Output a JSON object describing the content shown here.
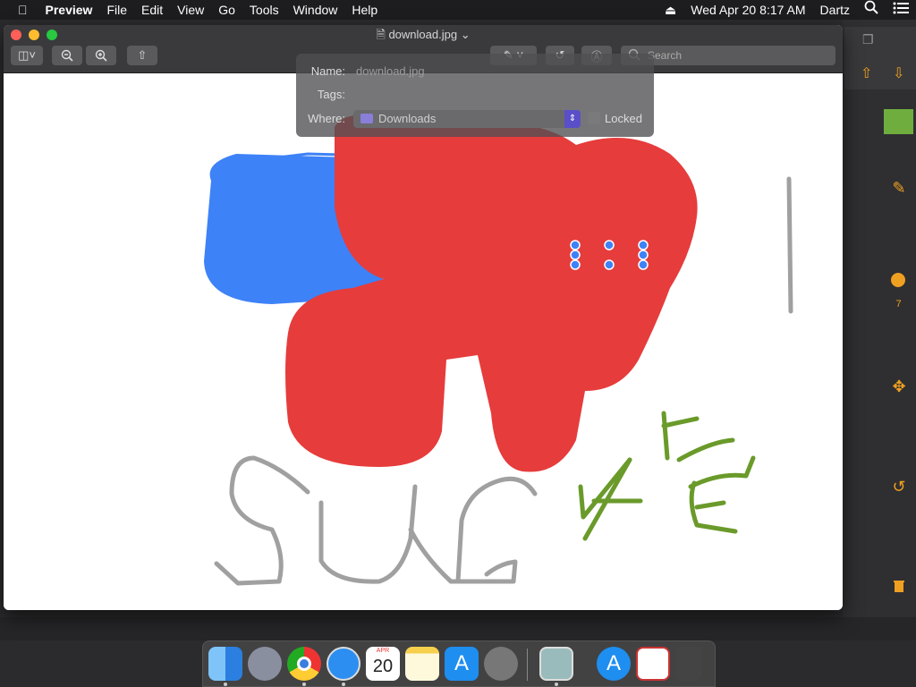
{
  "menubar": {
    "app": "Preview",
    "items": [
      "File",
      "Edit",
      "View",
      "Go",
      "Tools",
      "Window",
      "Help"
    ],
    "date": "Wed Apr 20",
    "time": "8:17 AM",
    "user": "Dartz"
  },
  "window": {
    "title": "download.jpg",
    "search_placeholder": "Search"
  },
  "popover": {
    "name_label": "Name:",
    "name_value": "download.jpg",
    "tags_label": "Tags:",
    "tags_value": "",
    "where_label": "Where:",
    "where_value": "Downloads",
    "locked_label": "Locked"
  },
  "inspector": {
    "size_value": "7"
  },
  "dock": {
    "calendar_month": "APR",
    "calendar_day": "20",
    "apps": [
      "Finder",
      "Launchpad",
      "Google Chrome",
      "Safari",
      "Calendar",
      "Notes",
      "App Store",
      "System Preferences",
      "Preview",
      "App Store Downloads",
      "Photo Booth",
      "Trash"
    ]
  },
  "colors": {
    "red_fill": "#e63c3c",
    "blue_fill": "#3e82f7",
    "green_stroke": "#6a9a2a",
    "gray_stroke": "#a0a0a0",
    "accent_orange": "#f0a020"
  },
  "canvas": {
    "drawn_text_gray": "SUC",
    "drawn_text_green": "rổ"
  }
}
